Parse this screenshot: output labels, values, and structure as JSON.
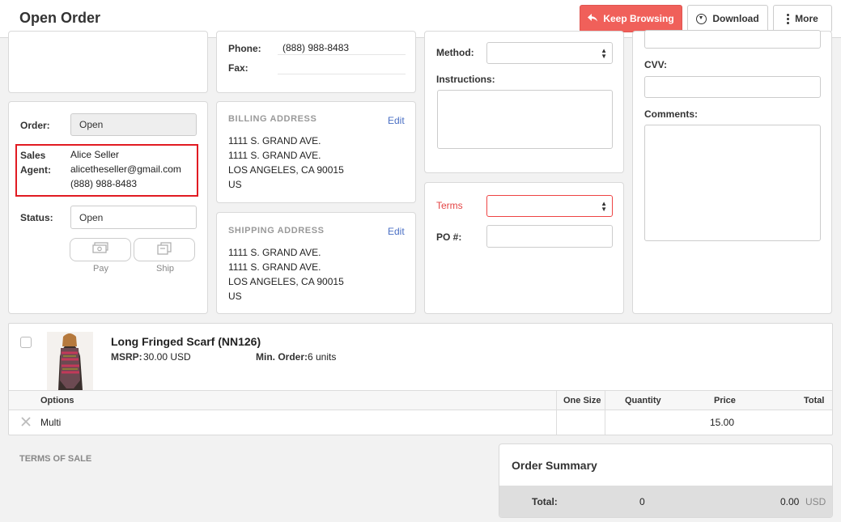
{
  "header": {
    "title": "Open Order",
    "keep_browsing_label": "Keep Browsing",
    "download_label": "Download",
    "more_label": "More"
  },
  "seller_contact": {
    "phone_label": "Phone:",
    "phone_value": "(888) 988-8483",
    "fax_label": "Fax:",
    "fax_value": ""
  },
  "order_info": {
    "order_label": "Order:",
    "order_value": "Open",
    "sales_agent_label_1": "Sales",
    "sales_agent_label_2": "Agent:",
    "agent_name": "Alice Seller",
    "agent_email": "alicetheseller@gmail.com",
    "agent_phone": "(888) 988-8483",
    "status_label": "Status:",
    "status_value": "Open",
    "pay_label": "Pay",
    "ship_label": "Ship"
  },
  "billing": {
    "heading": "BILLING ADDRESS",
    "edit_label": "Edit",
    "lines": [
      "1111 S. GRAND AVE.",
      "1111 S. GRAND AVE.",
      "LOS ANGELES, CA 90015",
      "US"
    ]
  },
  "shipping": {
    "heading": "SHIPPING ADDRESS",
    "edit_label": "Edit",
    "lines": [
      "1111 S. GRAND AVE.",
      "1111 S. GRAND AVE.",
      "LOS ANGELES, CA 90015",
      "US"
    ]
  },
  "shipping_method": {
    "method_label": "Method:",
    "method_value": "",
    "instructions_label": "Instructions:"
  },
  "terms": {
    "terms_label": "Terms",
    "terms_value": "",
    "po_label": "PO #:",
    "po_value": ""
  },
  "payment": {
    "cvv_label": "CVV:",
    "cvv_value": "",
    "comments_label": "Comments:"
  },
  "product": {
    "title": "Long Fringed Scarf (NN126)",
    "msrp_label": "MSRP:",
    "msrp_value": "30.00 USD",
    "min_order_label": "Min. Order:",
    "min_order_value": "6 units",
    "columns": [
      "Options",
      "One Size",
      "Quantity",
      "Price",
      "Total"
    ],
    "row": {
      "option": "Multi",
      "one_size": "",
      "quantity": "",
      "price": "15.00",
      "total": ""
    }
  },
  "terms_of_sale": {
    "title": "TERMS OF SALE"
  },
  "summary": {
    "title": "Order Summary",
    "total_label": "Total:",
    "quantity": "0",
    "amount": "0.00",
    "currency": "USD"
  },
  "colors": {
    "accent": "#f0605a",
    "highlight": "#e11b22",
    "link": "#4a6fc4",
    "required": "#e44444"
  }
}
